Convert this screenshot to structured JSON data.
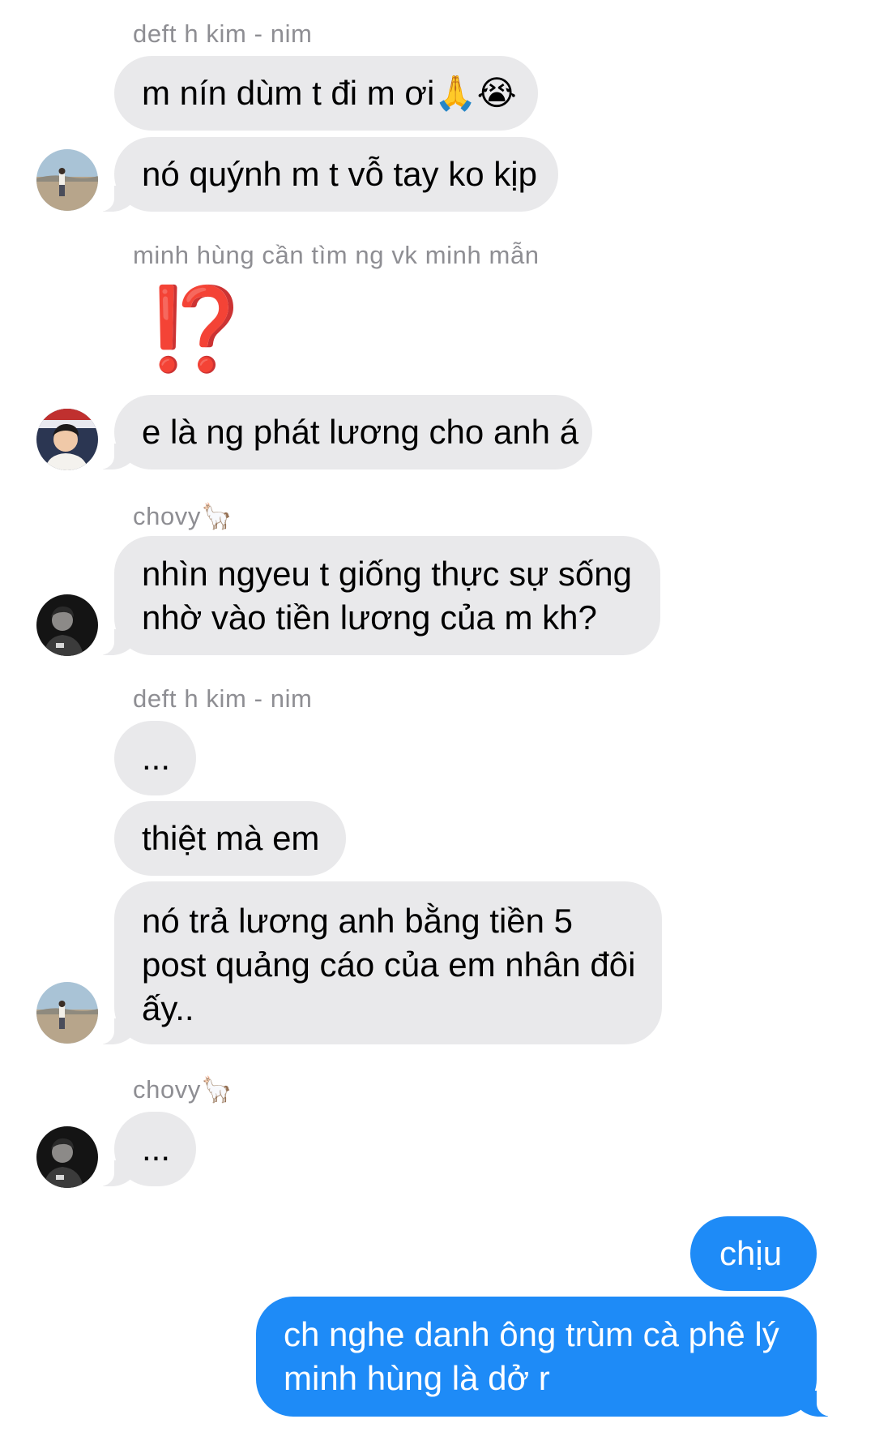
{
  "senders": {
    "deft1": "deft h kim - nim",
    "minh": "minh hùng cần tìm ng vk minh mẫn",
    "chovy1": "chovy🦙",
    "deft2": "deft h kim - nim",
    "chovy2": "chovy🦙"
  },
  "messages": {
    "m1": "m nín dùm t đi m ơi🙏😭",
    "m2": "nó quýnh m t vỗ tay ko kịp",
    "m3": "⁉️",
    "m4": "e là ng phát lương cho anh á",
    "m5": [
      "nhìn ngyeu t giống thực sự sống",
      "nhờ vào tiền lương của m kh?"
    ],
    "m6": "...",
    "m7": "thiệt mà em",
    "m8": [
      "nó trả lương anh bằng tiền 5",
      "post quảng cáo của em nhân đôi",
      "ấy.."
    ],
    "m9": "...",
    "m10": "chịu",
    "m11": [
      "ch nghe danh ông trùm cà phê lý",
      "minh hùng là dở r"
    ]
  },
  "colors": {
    "incoming_bubble": "#e9e9eb",
    "outgoing_bubble": "#1e8bf7",
    "sender_label": "#8e8e93"
  },
  "icons": {
    "deft_avatar": "person-desert-landscape-avatar",
    "minh_avatar": "smiling-person-avatar",
    "chovy_avatar": "dark-portrait-avatar"
  }
}
